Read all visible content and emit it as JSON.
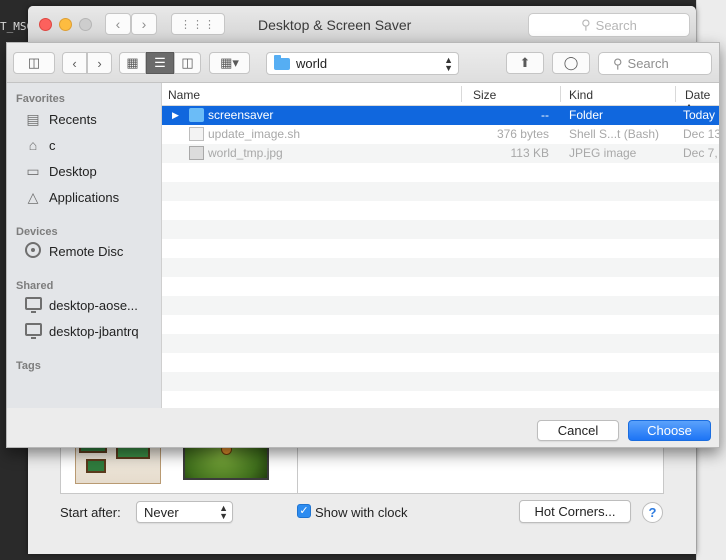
{
  "terminal": {
    "text": "T_MSG"
  },
  "prefs_window": {
    "title": "Desktop & Screen Saver",
    "search_placeholder": "Search",
    "start_after_label": "Start after:",
    "start_after_value": "Never",
    "show_clock_label": "Show with clock",
    "show_clock_checked": true,
    "hot_corners_label": "Hot Corners...",
    "help_label": "?"
  },
  "sheet": {
    "location": "world",
    "search_placeholder": "Search",
    "columns": {
      "name": "Name",
      "size": "Size",
      "kind": "Kind",
      "date": "Date A"
    },
    "files": [
      {
        "name": "screensaver",
        "size": "--",
        "kind": "Folder",
        "date": "Today",
        "selected": true,
        "enabled": true,
        "icon": "folder-icon"
      },
      {
        "name": "update_image.sh",
        "size": "376 bytes",
        "kind": "Shell S...t (Bash)",
        "date": "Dec 13",
        "selected": false,
        "enabled": false,
        "icon": "document-icon"
      },
      {
        "name": "world_tmp.jpg",
        "size": "113 KB",
        "kind": "JPEG image",
        "date": "Dec 7,",
        "selected": false,
        "enabled": false,
        "icon": "image-icon"
      }
    ],
    "cancel_label": "Cancel",
    "choose_label": "Choose"
  },
  "sidebar": {
    "favorites_heading": "Favorites",
    "favorites": [
      {
        "label": "Recents",
        "icon": "recents-icon"
      },
      {
        "label": "c",
        "icon": "home-icon"
      },
      {
        "label": "Desktop",
        "icon": "desktop-icon"
      },
      {
        "label": "Applications",
        "icon": "applications-icon"
      }
    ],
    "devices_heading": "Devices",
    "devices": [
      {
        "label": "Remote Disc",
        "icon": "disc-icon"
      }
    ],
    "shared_heading": "Shared",
    "shared": [
      {
        "label": "desktop-aose...",
        "icon": "computer-icon"
      },
      {
        "label": "desktop-jbantrq",
        "icon": "computer-icon"
      }
    ],
    "tags_heading": "Tags"
  }
}
